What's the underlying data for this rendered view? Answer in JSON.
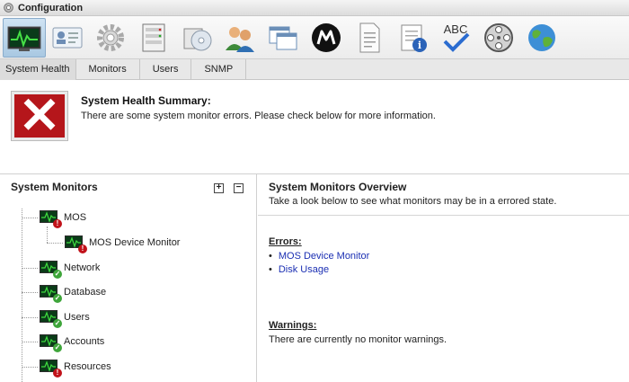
{
  "window": {
    "title": "Configuration"
  },
  "toolbar": {
    "items": [
      {
        "icon": "system-health-monitor-icon",
        "active": true
      },
      {
        "icon": "id-card-icon"
      },
      {
        "icon": "gear-icon"
      },
      {
        "icon": "server-rack-icon"
      },
      {
        "icon": "software-cd-icon"
      },
      {
        "icon": "users-icon"
      },
      {
        "icon": "windows-icon"
      },
      {
        "icon": "m-logo-icon"
      },
      {
        "icon": "document-icon"
      },
      {
        "icon": "info-notepad-icon"
      },
      {
        "icon": "spellcheck-icon"
      },
      {
        "icon": "film-reel-icon"
      },
      {
        "icon": "globe-icon"
      }
    ]
  },
  "tabs": [
    "System Health",
    "Monitors",
    "Users",
    "SNMP"
  ],
  "summary": {
    "title": "System Health Summary:",
    "message": "There are some system monitor errors. Please check below for more information."
  },
  "monitors_panel": {
    "title": "System Monitors",
    "expand_all": "+",
    "collapse_all": "−",
    "tree": [
      {
        "label": "MOS",
        "status": "error"
      },
      {
        "label": "MOS Device Monitor",
        "status": "error",
        "child": true
      },
      {
        "label": "Network",
        "status": "ok"
      },
      {
        "label": "Database",
        "status": "ok"
      },
      {
        "label": "Users",
        "status": "ok"
      },
      {
        "label": "Accounts",
        "status": "ok"
      },
      {
        "label": "Resources",
        "status": "error"
      }
    ]
  },
  "overview": {
    "title": "System Monitors Overview",
    "subtitle": "Take a look below to see what monitors may be in a errored state.",
    "errors_heading": "Errors:",
    "errors": [
      "MOS Device Monitor",
      "Disk Usage"
    ],
    "warnings_heading": "Warnings:",
    "warnings_text": "There are currently no monitor warnings."
  },
  "colors": {
    "error": "#b5161b",
    "ok": "#3ea53a",
    "link": "#1b2fb3"
  }
}
